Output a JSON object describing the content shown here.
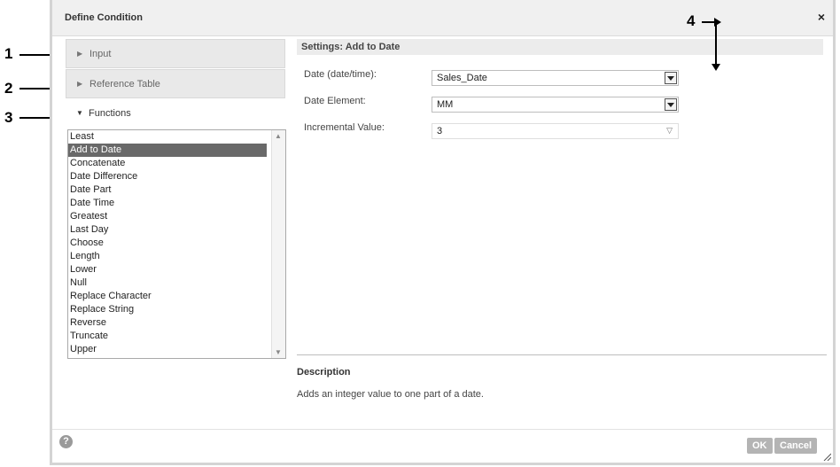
{
  "callouts": [
    "1",
    "2",
    "3",
    "4"
  ],
  "dialog": {
    "title": "Define Condition",
    "close_glyph": "×"
  },
  "accordion": [
    {
      "label": "Input",
      "expanded": false,
      "icon": "triangle-right-icon"
    },
    {
      "label": "Reference Table",
      "expanded": false,
      "icon": "triangle-right-icon"
    },
    {
      "label": "Functions",
      "expanded": true,
      "icon": "triangle-down-icon"
    }
  ],
  "functions": {
    "items": [
      "Least",
      "Add to Date",
      "Concatenate",
      "Date Difference",
      "Date Part",
      "Date Time",
      "Greatest",
      "Last Day",
      "Choose",
      "Length",
      "Lower",
      "Null",
      "Replace Character",
      "Replace String",
      "Reverse",
      "Truncate",
      "Upper"
    ],
    "selected": "Add to Date"
  },
  "settings": {
    "title": "Settings: Add to Date",
    "fields": [
      {
        "label": "Date (date/time):",
        "value": "Sales_Date",
        "kind": "dropdown"
      },
      {
        "label": "Date Element:",
        "value": "MM",
        "kind": "dropdown"
      },
      {
        "label": "Incremental Value:",
        "value": "3",
        "kind": "combo"
      }
    ]
  },
  "description": {
    "title": "Description",
    "text": "Adds an integer value to one part of a date."
  },
  "footer": {
    "help": "?",
    "ok_label": "OK",
    "cancel_label": "Cancel"
  }
}
